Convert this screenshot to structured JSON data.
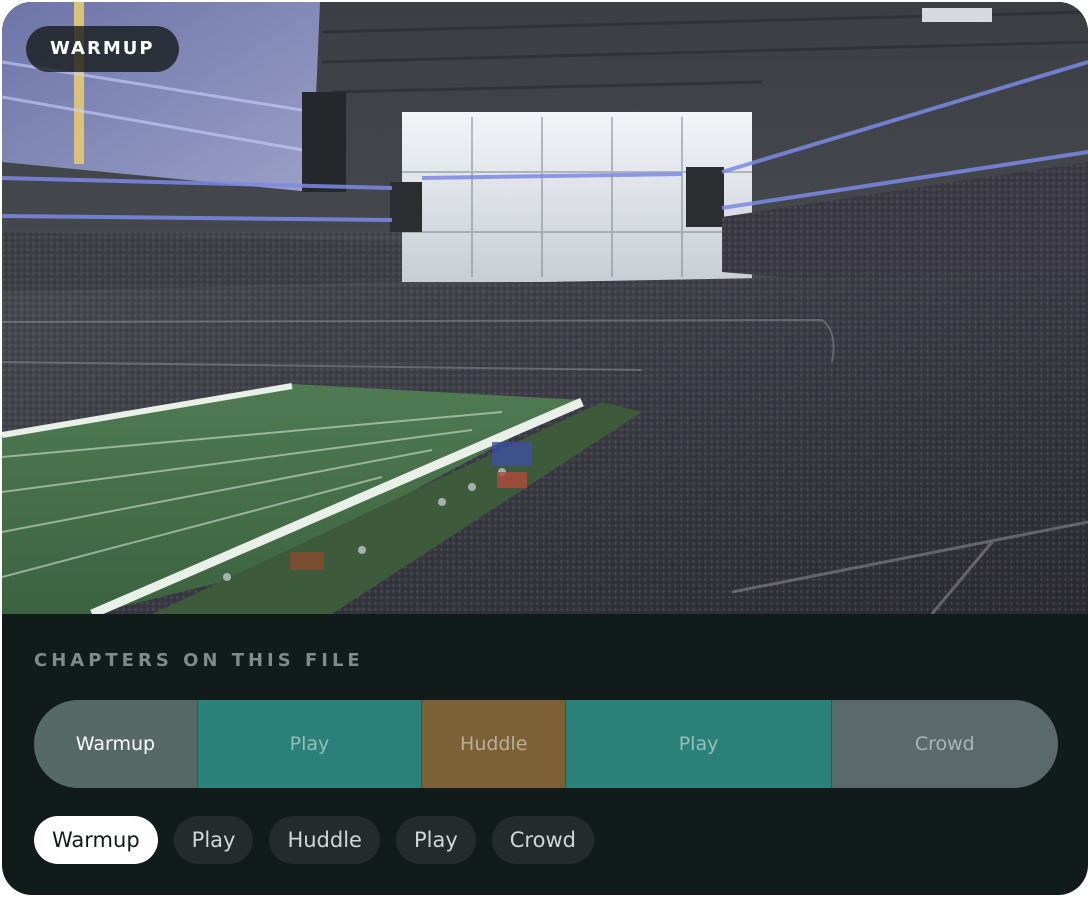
{
  "video": {
    "current_chapter_label": "WARMUP"
  },
  "panel": {
    "title": "CHAPTERS ON THIS FILE"
  },
  "chapters": [
    {
      "label": "Warmup",
      "share": 0.159,
      "color": "#566a65",
      "active": true
    },
    {
      "label": "Play",
      "share": 0.219,
      "color": "#2a8179",
      "active": false
    },
    {
      "label": "Huddle",
      "share": 0.141,
      "color": "#7b6135",
      "active": false
    },
    {
      "label": "Play",
      "share": 0.259,
      "color": "#2a8179",
      "active": false
    },
    {
      "label": "Crowd",
      "share": 0.222,
      "color": "#5a6a6b",
      "active": false
    }
  ],
  "pills": [
    {
      "label": "Warmup",
      "active": true
    },
    {
      "label": "Play",
      "active": false
    },
    {
      "label": "Huddle",
      "active": false
    },
    {
      "label": "Play",
      "active": false
    },
    {
      "label": "Crowd",
      "active": false
    }
  ]
}
